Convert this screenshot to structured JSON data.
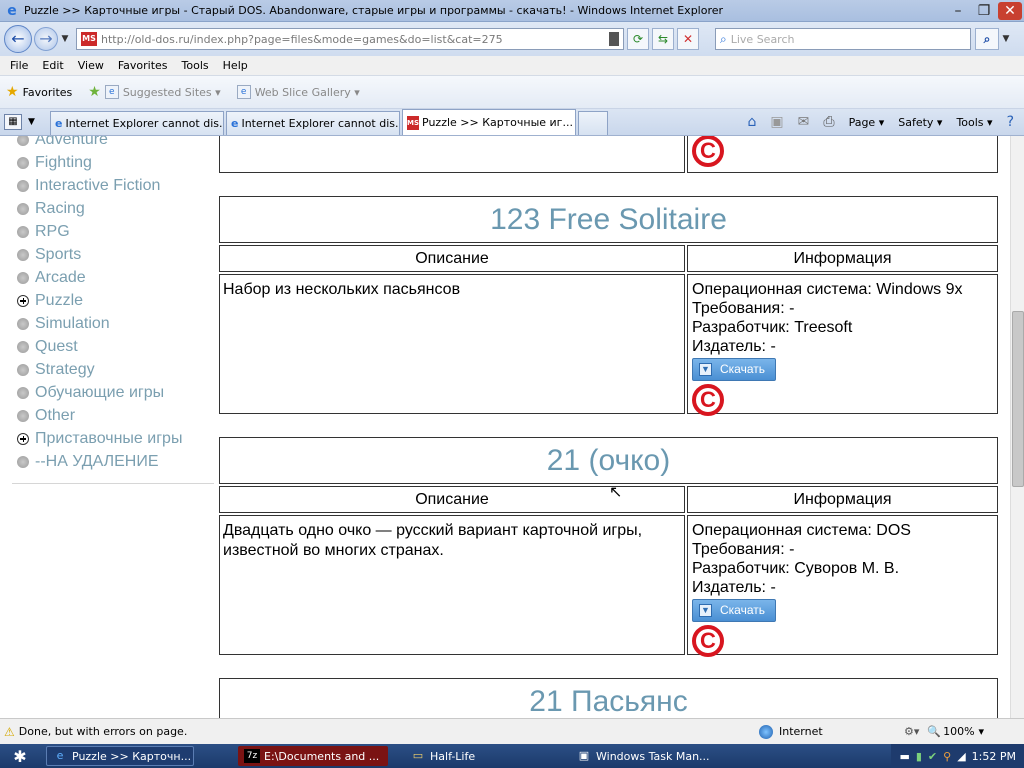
{
  "window": {
    "title": "Puzzle >> Карточные игры - Старый DOS. Abandonware, старые игры и программы - скачать! - Windows Internet Explorer"
  },
  "address_bar": {
    "url": "http://old-dos.ru/index.php?page=files&mode=games&do=list&cat=275",
    "search_placeholder": "Live Search"
  },
  "menu": [
    "File",
    "Edit",
    "View",
    "Favorites",
    "Tools",
    "Help"
  ],
  "favorites_bar": {
    "favorites_label": "Favorites",
    "items": [
      "Suggested Sites ▾",
      "Web Slice Gallery ▾"
    ]
  },
  "tabs": [
    {
      "label": "Internet Explorer cannot dis...",
      "active": false
    },
    {
      "label": "Internet Explorer cannot dis...",
      "active": false
    },
    {
      "label": "Puzzle >> Карточные иг...",
      "active": true
    }
  ],
  "command_bar": {
    "page": "Page ▾",
    "safety": "Safety ▾",
    "tools": "Tools ▾"
  },
  "sidebar": {
    "categories": [
      {
        "label": "Adventure",
        "expandable": false
      },
      {
        "label": "Fighting",
        "expandable": false
      },
      {
        "label": "Interactive Fiction",
        "expandable": false
      },
      {
        "label": "Racing",
        "expandable": false
      },
      {
        "label": "RPG",
        "expandable": false
      },
      {
        "label": "Sports",
        "expandable": false
      },
      {
        "label": "Arcade",
        "expandable": false
      },
      {
        "label": "Puzzle",
        "expandable": true
      },
      {
        "label": "Simulation",
        "expandable": false
      },
      {
        "label": "Quest",
        "expandable": false
      },
      {
        "label": "Strategy",
        "expandable": false
      },
      {
        "label": "Обучающие игры",
        "expandable": false
      },
      {
        "label": "Other",
        "expandable": false
      },
      {
        "label": "Приставочные игры",
        "expandable": true
      },
      {
        "label": "--НА УДАЛЕНИЕ",
        "expandable": false
      }
    ]
  },
  "games": {
    "headers": {
      "description": "Описание",
      "info": "Информация"
    },
    "download_label": "Скачать",
    "copyright_symbol": "C",
    "game1": {
      "title": "123 Free Solitaire",
      "description": "Набор из нескольких пасьянсов",
      "os": "Операционная система: Windows 9x",
      "requirements": "Требования: -",
      "developer": "Разработчик: Treesoft",
      "publisher": "Издатель: -"
    },
    "game2": {
      "title": "21 (очко)",
      "description": "Двадцать одно очко — русский вариант карточной игры, известной во многих странах.",
      "os": "Операционная система: DOS",
      "requirements": "Требования: -",
      "developer": "Разработчик: Суворов М. В.",
      "publisher": "Издатель: -"
    },
    "game3": {
      "title": "21 Пасьянс"
    }
  },
  "status_bar": {
    "message": "Done, but with errors on page.",
    "zone": "Internet",
    "zoom": "100%"
  },
  "taskbar": {
    "tasks": [
      "Puzzle >> Карточн...",
      "E:\\Documents and ...",
      "Half-Life",
      "Windows Task Man..."
    ],
    "clock": "1:52 PM"
  }
}
